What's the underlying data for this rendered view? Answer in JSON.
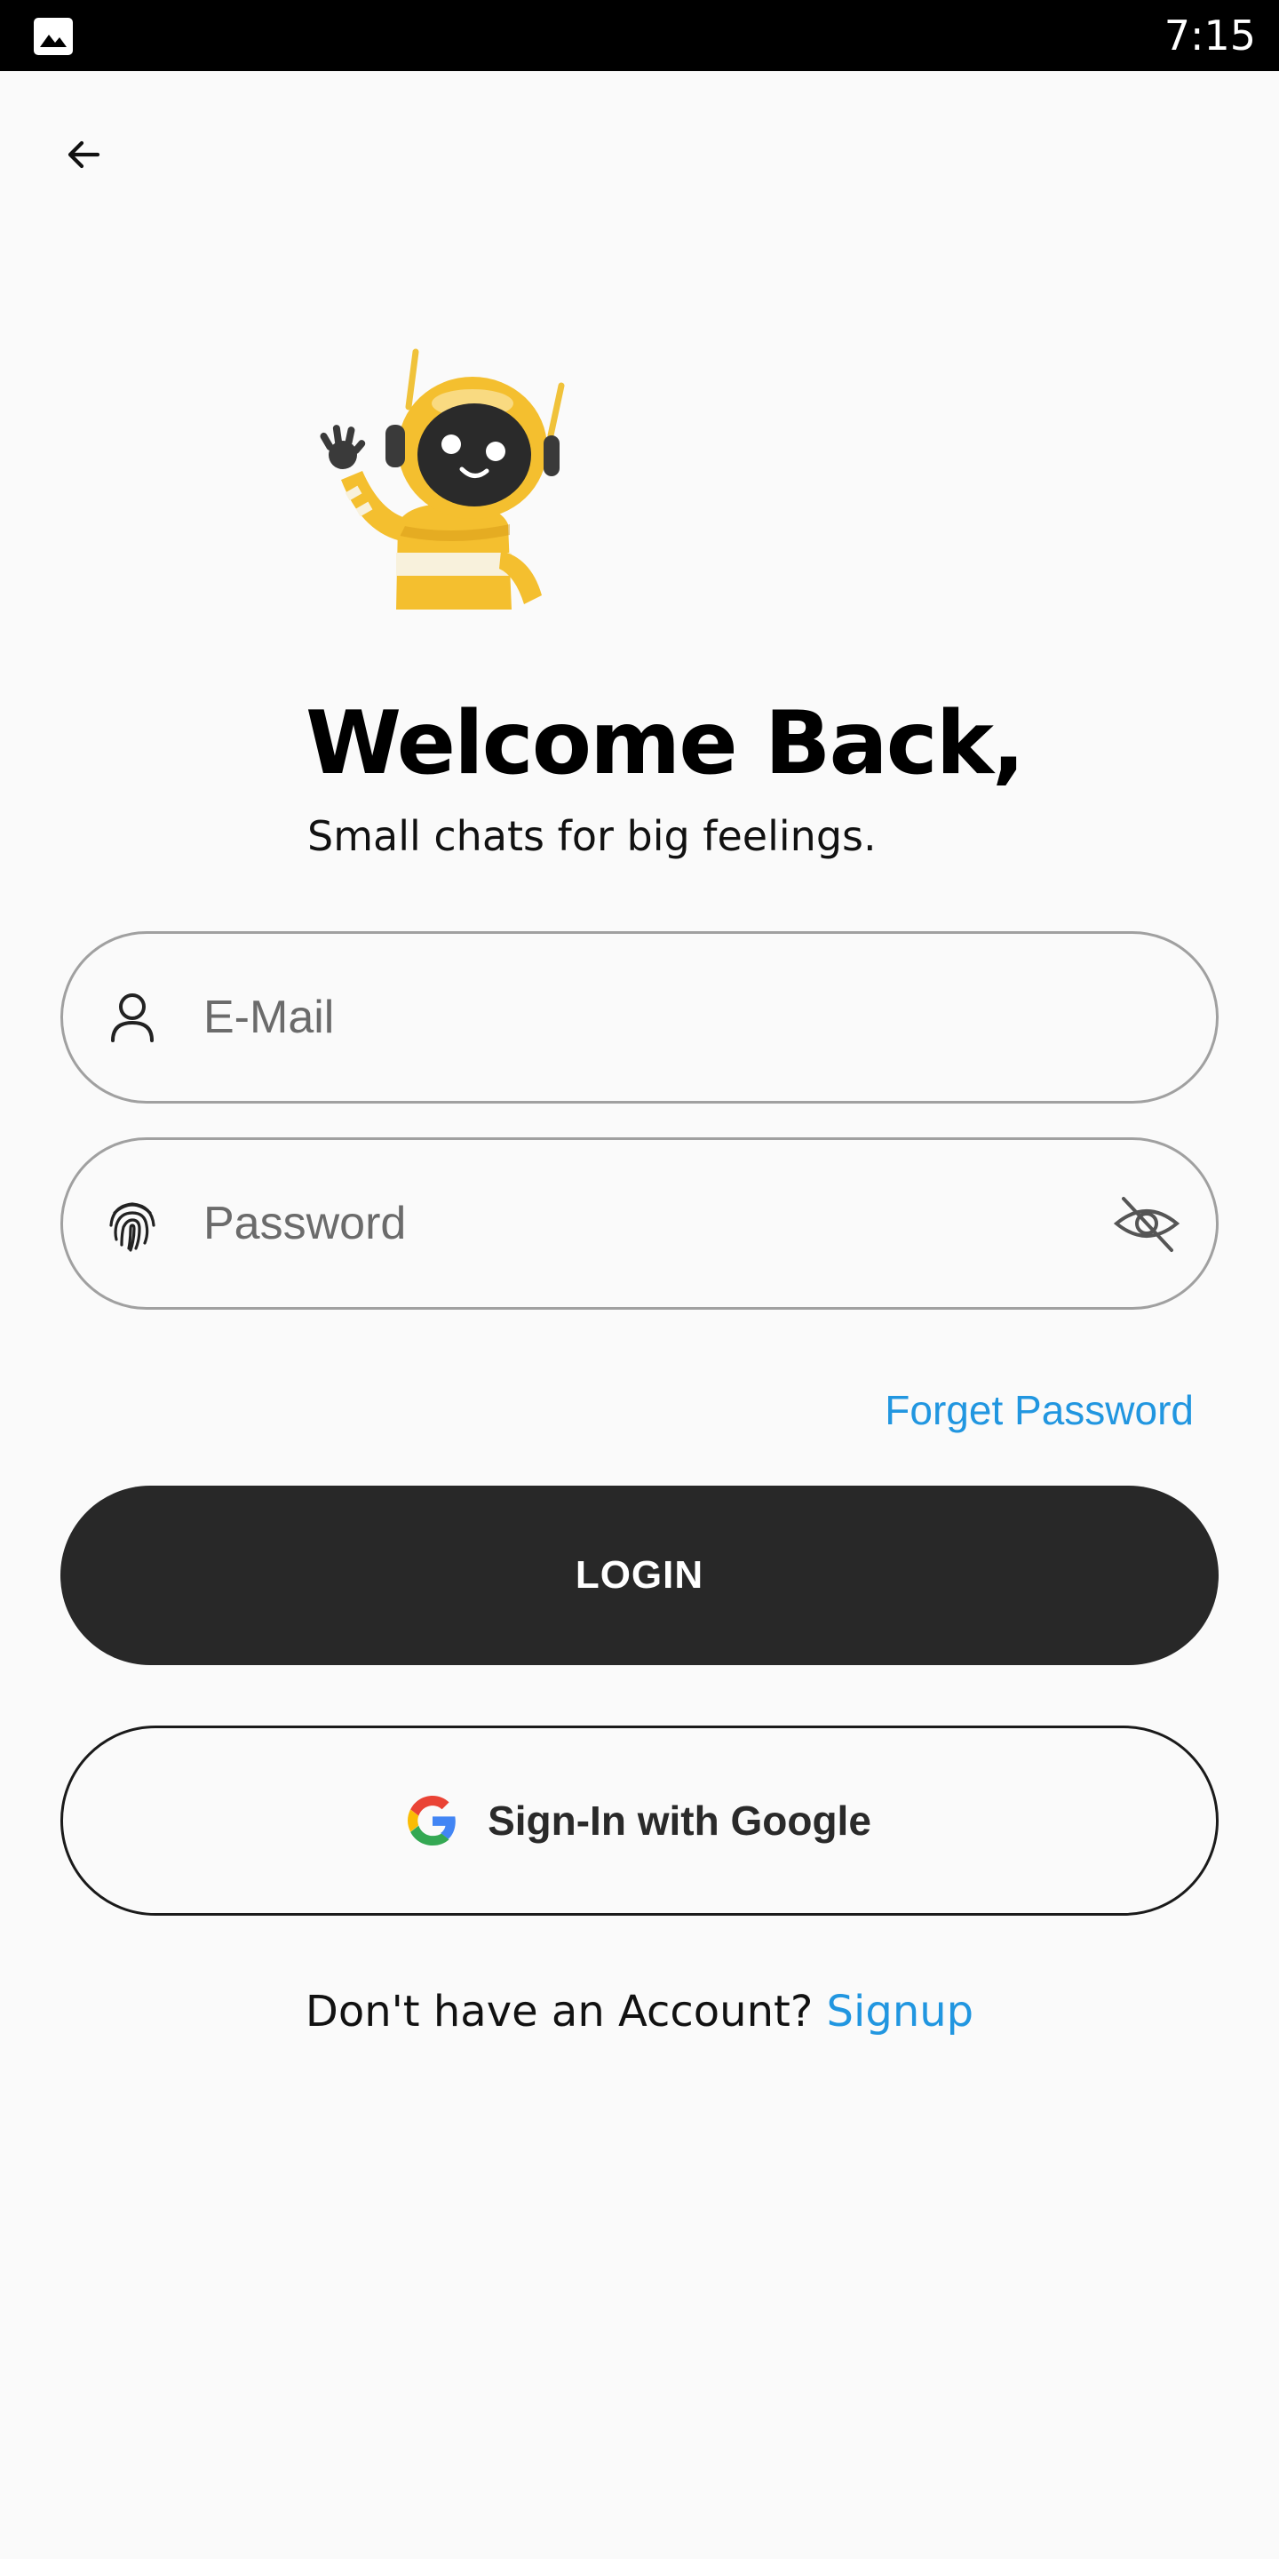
{
  "status_bar": {
    "time": "7:15",
    "left_icon": "image-icon"
  },
  "nav": {
    "back_icon": "arrow-left-icon"
  },
  "hero": {
    "mascot": "waving-robot-illustration",
    "title": "Welcome Back,",
    "subtitle": "Small chats for big feelings."
  },
  "form": {
    "email": {
      "placeholder": "E-Mail",
      "value": "",
      "icon": "user-icon"
    },
    "password": {
      "placeholder": "Password",
      "value": "",
      "icon": "fingerprint-icon",
      "toggle_icon": "eye-off-icon"
    },
    "forget_password_label": "Forget Password",
    "login_label": "LOGIN",
    "google_label": "Sign-In with Google",
    "google_icon": "google-icon"
  },
  "footer": {
    "prompt": "Don't have an Account?",
    "signup_label": "Signup"
  },
  "colors": {
    "background": "#fafafa",
    "status_bar": "#000000",
    "accent_link": "#2196e0",
    "primary_button": "#282828",
    "field_border": "#a0a0a0"
  }
}
